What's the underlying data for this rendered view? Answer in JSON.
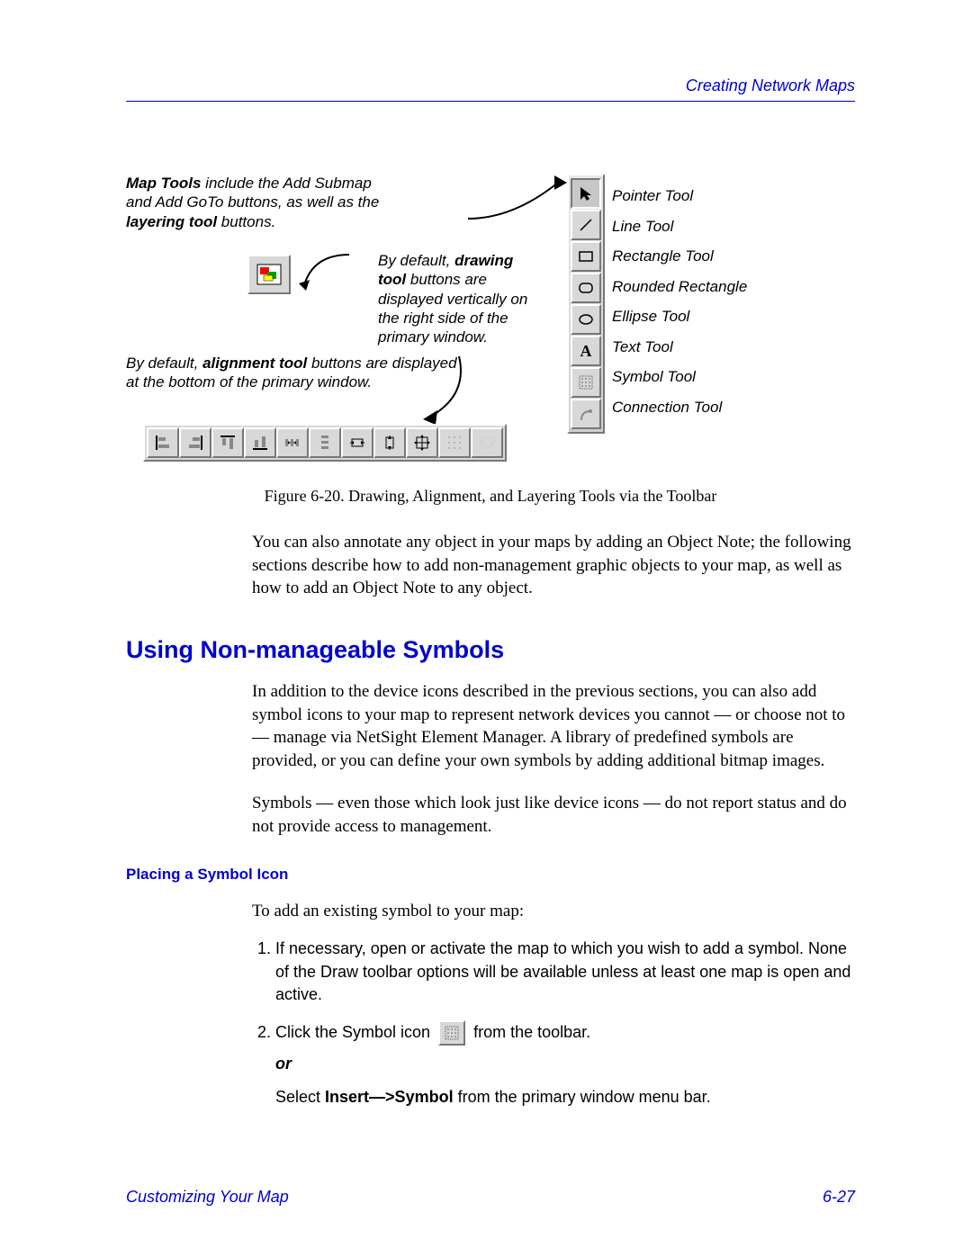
{
  "header": {
    "running_head": "Creating Network Maps"
  },
  "figure": {
    "callout_maptools_pre": "Map Tools",
    "callout_maptools_mid": " include the Add Submap and Add GoTo buttons, as well as the ",
    "callout_maptools_bold2": "layering tool",
    "callout_maptools_post": " buttons.",
    "callout_drawing_pre": "By default, ",
    "callout_drawing_bold": "drawing tool",
    "callout_drawing_post": " buttons are displayed vertically on the right side of the primary window.",
    "callout_align_pre": "By default, ",
    "callout_align_bold": "alignment tool",
    "callout_align_post": " buttons are displayed at the bottom of the primary window.",
    "tools": {
      "pointer": "Pointer Tool",
      "line": "Line Tool",
      "rect": "Rectangle Tool",
      "rrect": "Rounded Rectangle",
      "ellipse": "Ellipse Tool",
      "text": "Text Tool",
      "symbol": "Symbol Tool",
      "connection": "Connection Tool"
    },
    "caption": "Figure 6-20.  Drawing, Alignment, and Layering Tools via the Toolbar"
  },
  "para1": "You can also annotate any object in your maps by adding an Object Note; the following sections describe how to add non-management graphic objects to your map, as well as how to add an Object Note to any object.",
  "section_title": "Using Non-manageable Symbols",
  "para2": "In addition to the device icons described in the previous sections, you can also add symbol icons to your map to represent network devices you cannot — or choose not to — manage via NetSight Element Manager. A library of predefined symbols are provided, or you can define your own symbols by adding additional bitmap images.",
  "para3": "Symbols — even those which look just like device icons — do not report status and do not provide access to management.",
  "subsection_title": "Placing a Symbol Icon",
  "steps_lead": "To add an existing symbol to your map:",
  "step1": "If necessary, open or activate the map to which you wish to add a symbol. None of the Draw toolbar options will be available unless at least one map is open and active.",
  "step2_pre": "Click the Symbol icon ",
  "step2_post": " from the toolbar.",
  "step_or": "or",
  "step3_pre": "Select ",
  "step3_bold": "Insert—>Symbol",
  "step3_post": " from the primary window menu bar.",
  "footer": {
    "left": "Customizing Your Map",
    "page": "6-27"
  }
}
